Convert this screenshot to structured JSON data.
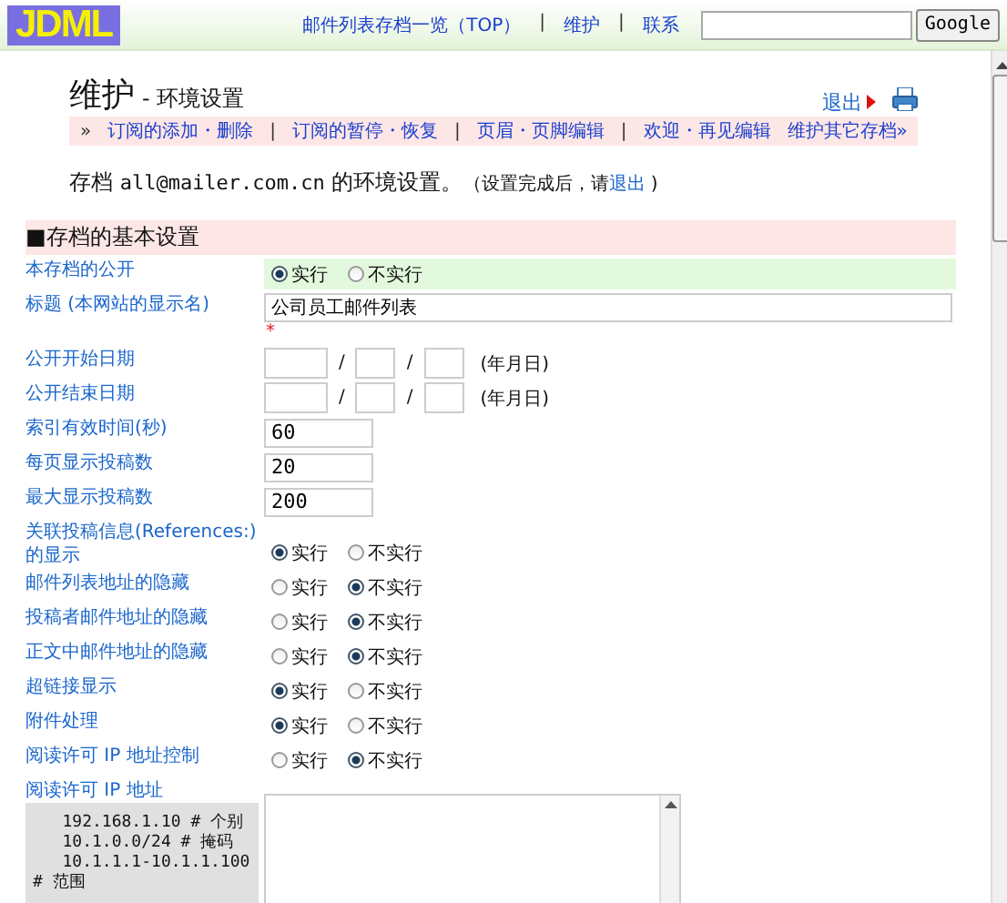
{
  "header": {
    "logo": "JDML",
    "nav": [
      {
        "kind": "link",
        "label": "邮件列表存档一览（TOP）"
      },
      {
        "kind": "separator",
        "label": "|"
      },
      {
        "kind": "link",
        "label": "维护"
      },
      {
        "kind": "separator",
        "label": "|"
      },
      {
        "kind": "link",
        "label": "联系"
      }
    ],
    "search_button": "Google"
  },
  "page": {
    "title": "维护",
    "subtitle": "- 环境设置",
    "logout": "退出",
    "subnav": [
      {
        "kind": "separator",
        "label": "»"
      },
      {
        "kind": "link",
        "label": "订阅的添加・删除"
      },
      {
        "kind": "separator",
        "label": "|"
      },
      {
        "kind": "link",
        "label": "订阅的暂停・恢复"
      },
      {
        "kind": "separator",
        "label": "|"
      },
      {
        "kind": "link",
        "label": "页眉・页脚编辑"
      },
      {
        "kind": "separator",
        "label": "|"
      },
      {
        "kind": "link",
        "label": "欢迎・再见编辑"
      },
      {
        "kind": "link",
        "label": "维护其它存档»"
      }
    ],
    "intro": {
      "prefix": "存档 ",
      "address": "all@mailer.com.cn",
      "suffix": " 的环境设置。",
      "note": "（设置完成后，请",
      "link": "退出",
      "note_end": " )"
    }
  },
  "section": {
    "title": "■存档的基本设置",
    "rows": [
      {
        "kind": "radio",
        "label": "本存档的公开",
        "highlighted": true,
        "options": [
          {
            "label": "实行",
            "selected": true
          },
          {
            "label": "不实行",
            "selected": false
          }
        ]
      },
      {
        "kind": "text",
        "label": "标题 (本网站的显示名)",
        "value": "公司员工邮件列表",
        "required_mark": "*"
      },
      {
        "kind": "date",
        "label": "公开开始日期",
        "separators": [
          "/",
          "/"
        ],
        "suffix": "(年月日)"
      },
      {
        "kind": "date",
        "label": "公开结束日期",
        "separators": [
          "/",
          "/"
        ],
        "suffix": "(年月日)"
      },
      {
        "kind": "number",
        "label": "索引有效时间(秒)",
        "value": "60"
      },
      {
        "kind": "number",
        "label": "每页显示投稿数",
        "value": "20"
      },
      {
        "kind": "number",
        "label": "最大显示投稿数",
        "value": "200"
      },
      {
        "kind": "radio",
        "label": "关联投稿信息(References:)的显示",
        "highlighted": false,
        "options": [
          {
            "label": "实行",
            "selected": true
          },
          {
            "label": "不实行",
            "selected": false
          }
        ]
      },
      {
        "kind": "radio",
        "label": "邮件列表地址的隐藏",
        "highlighted": false,
        "options": [
          {
            "label": "实行",
            "selected": false
          },
          {
            "label": "不实行",
            "selected": true
          }
        ]
      },
      {
        "kind": "radio",
        "label": "投稿者邮件地址的隐藏",
        "highlighted": false,
        "options": [
          {
            "label": "实行",
            "selected": false
          },
          {
            "label": "不实行",
            "selected": true
          }
        ]
      },
      {
        "kind": "radio",
        "label": "正文中邮件地址的隐藏",
        "highlighted": false,
        "options": [
          {
            "label": "实行",
            "selected": false
          },
          {
            "label": "不实行",
            "selected": true
          }
        ]
      },
      {
        "kind": "radio",
        "label": "超链接显示",
        "highlighted": false,
        "options": [
          {
            "label": "实行",
            "selected": true
          },
          {
            "label": "不实行",
            "selected": false
          }
        ]
      },
      {
        "kind": "radio",
        "label": "附件处理",
        "highlighted": false,
        "options": [
          {
            "label": "实行",
            "selected": true
          },
          {
            "label": "不实行",
            "selected": false
          }
        ]
      },
      {
        "kind": "radio",
        "label": "阅读许可 IP 地址控制",
        "highlighted": false,
        "options": [
          {
            "label": "实行",
            "selected": false
          },
          {
            "label": "不实行",
            "selected": true
          }
        ]
      },
      {
        "kind": "textarea",
        "label": "阅读许可 IP 地址",
        "hint": "   192.168.1.10 # 个别\n   10.1.0.0/24 # 掩码\n   10.1.1.1-10.1.1.100\n# 范围"
      }
    ]
  }
}
